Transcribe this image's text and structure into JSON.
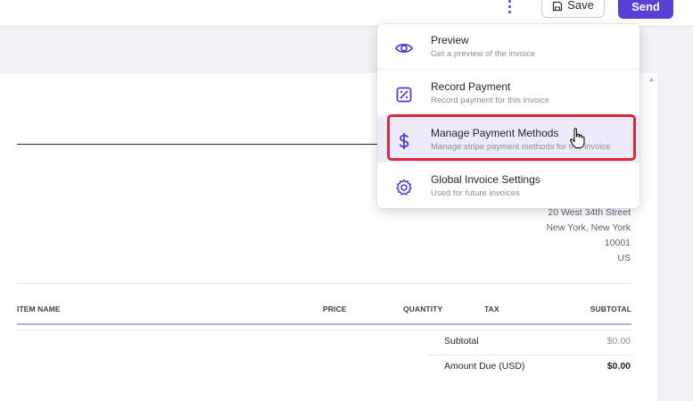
{
  "toolbar": {
    "more_icon": "vertical-dots-icon",
    "save_label": "Save",
    "save_icon": "floppy-disk-icon",
    "send_label": "Send",
    "accent": "#5a3fd6"
  },
  "menu": {
    "items": [
      {
        "title": "Preview",
        "subtitle": "Get a preview of the invoice",
        "icon": "eye-icon"
      },
      {
        "title": "Record Payment",
        "subtitle": "Record payment for this invoice",
        "icon": "percent-square-icon"
      },
      {
        "title": "Manage Payment Methods",
        "subtitle": "Manage stripe payment methods for this invoice",
        "icon": "dollar-icon"
      },
      {
        "title": "Global Invoice Settings",
        "subtitle": "Used for future invoices",
        "icon": "gear-icon"
      }
    ],
    "highlight_color": "#e0263b"
  },
  "invoice": {
    "address": [
      "20 West 34th Street",
      "New York, New York",
      "10001",
      "US"
    ],
    "columns": [
      "ITEM NAME",
      "PRICE",
      "QUANTITY",
      "TAX",
      "SUBTOTAL"
    ],
    "subtotal_label": "Subtotal",
    "subtotal_value": "$0.00",
    "amount_due_label": "Amount Due (USD)",
    "amount_due_value": "$0.00"
  }
}
